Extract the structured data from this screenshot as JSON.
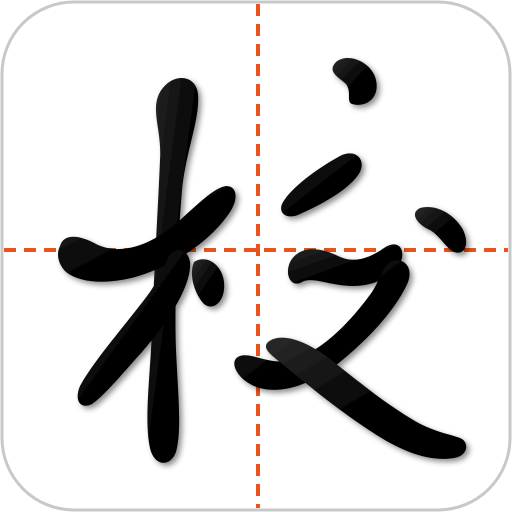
{
  "icon": {
    "glyph": "校",
    "icon_name": "calligraphy-practice-icon"
  },
  "colors": {
    "background": "#ffffff",
    "border": "#c8c8c8",
    "guide_line": "#e8541c",
    "ink": "#0a0a0a"
  }
}
